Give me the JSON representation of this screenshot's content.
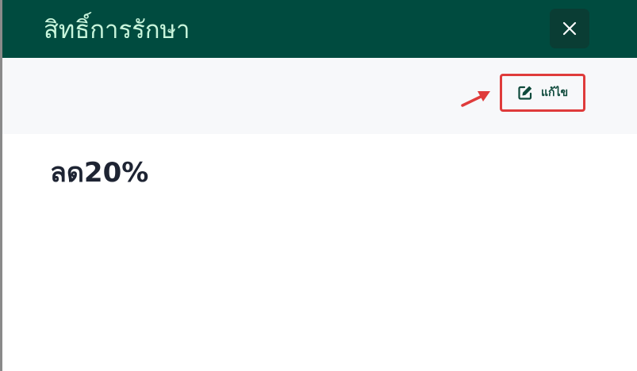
{
  "header": {
    "title": "สิทธิ์การรักษา",
    "close_icon": "close-icon"
  },
  "toolbar": {
    "edit_label": "แก้ไข",
    "edit_icon": "pencil-square-icon",
    "annotation_icon": "arrow-icon"
  },
  "content": {
    "value": "ลด20%"
  },
  "colors": {
    "header_bg": "#004b3f",
    "title_text": "#c8f5dc",
    "close_bg": "#0a3d34",
    "toolbar_bg": "#f7f8fa",
    "accent_green": "#0f4a3c",
    "highlight_red": "#df3b3b",
    "body_text": "#1e2433"
  }
}
